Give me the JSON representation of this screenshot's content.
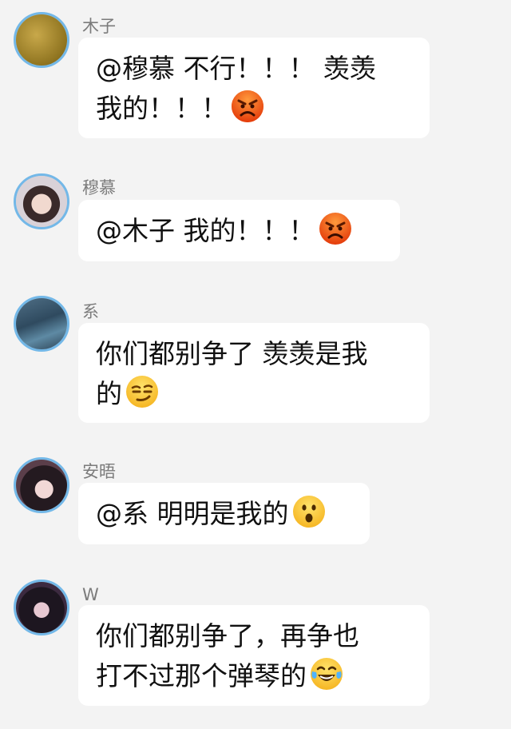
{
  "messages": [
    {
      "name": "木子",
      "lines": [
        "@穆慕 不行！！！ 羡羡",
        "我的！！！"
      ],
      "emoji": "angry-face-icon"
    },
    {
      "name": "穆慕",
      "lines": [
        "@木子 我的！！！"
      ],
      "emoji": "angry-face-icon"
    },
    {
      "name": "系",
      "lines": [
        "你们都别争了 羡羡是我",
        "的"
      ],
      "emoji": "smirk-face-icon"
    },
    {
      "name": "安晤",
      "lines": [
        "@系 明明是我的"
      ],
      "emoji": "surprised-face-icon"
    },
    {
      "name": "W",
      "lines": [
        "你们都别争了，再争也",
        "打不过那个弹琴的"
      ],
      "emoji": "tears-of-joy-face-icon"
    }
  ],
  "colors": {
    "background": "#f3f3f3",
    "bubble": "#ffffff",
    "avatar_border": "#73b8e8",
    "name": "#7b7b7b"
  }
}
